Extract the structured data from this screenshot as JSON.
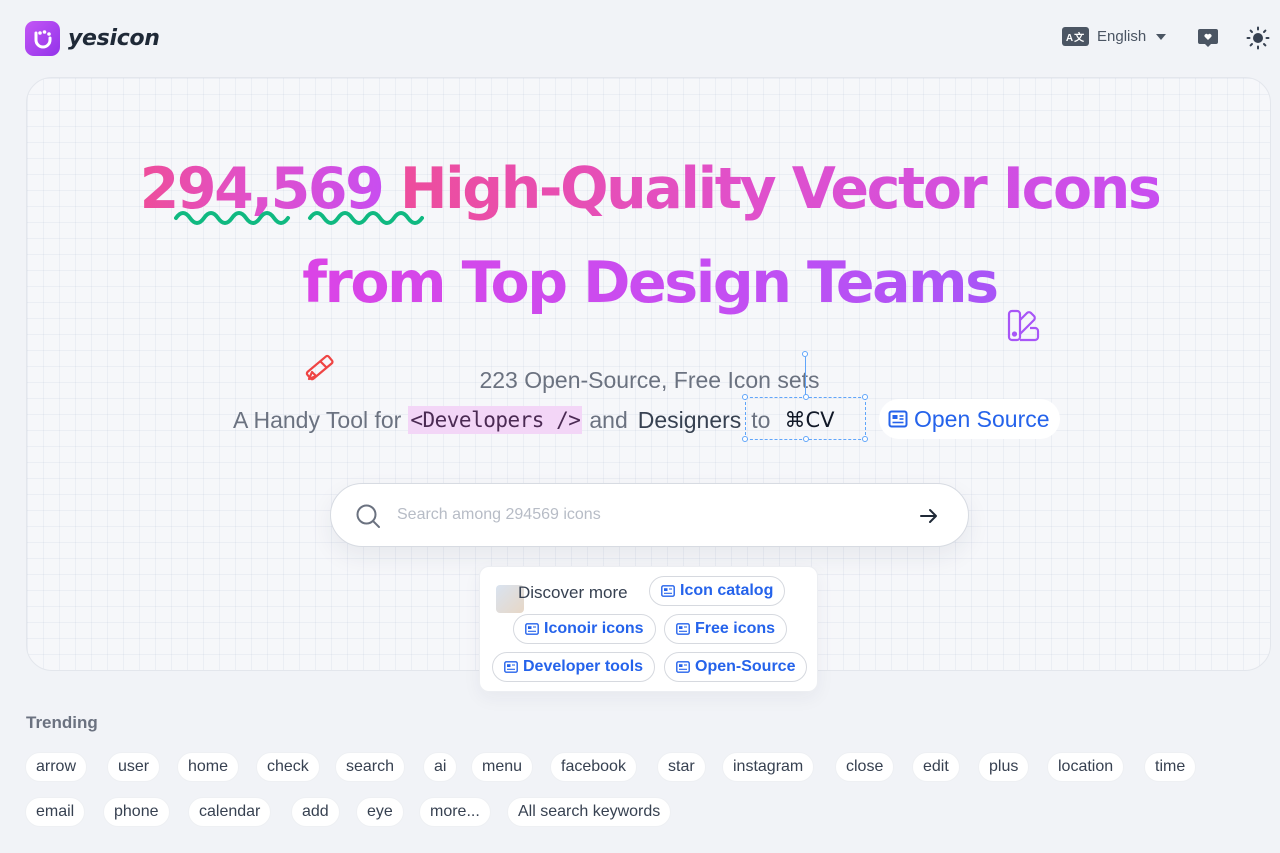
{
  "brand": {
    "name": "yesicon"
  },
  "header": {
    "language_label": "English",
    "language_icon_text": "A文"
  },
  "hero": {
    "count": "294,569",
    "title_rest_line1": " High-Quality Vector Icons",
    "title_line2": "from Top Design Teams",
    "subtitle1": "223 Open-Source, Free Icon sets",
    "subtitle2_prefix": "A Handy Tool for",
    "developers_tag": "<Developers />",
    "and_text": "and",
    "designers_text": "Designers",
    "to_text": "to",
    "shortcut_text": "⌘CV",
    "open_source_label": "Open Source"
  },
  "search": {
    "placeholder": "Search among 294569 icons",
    "value": ""
  },
  "discover": {
    "title": "Discover more",
    "chips": [
      "Icon catalog",
      "Iconoir icons",
      "Free icons",
      "Developer tools",
      "Open-Source"
    ]
  },
  "trending": {
    "title": "Trending",
    "row1": [
      "arrow",
      "user",
      "home",
      "check",
      "search",
      "ai",
      "menu",
      "facebook",
      "star",
      "instagram",
      "close",
      "edit",
      "plus",
      "location",
      "time"
    ],
    "row2": [
      "email",
      "phone",
      "calendar",
      "add",
      "eye",
      "more...",
      "All search keywords"
    ]
  },
  "colors": {
    "accent": "#2563eb",
    "gradient_start": "#ee4d9a",
    "gradient_end": "#c84ef0",
    "squiggle": "#10b981",
    "selection": "#60a5fa"
  }
}
